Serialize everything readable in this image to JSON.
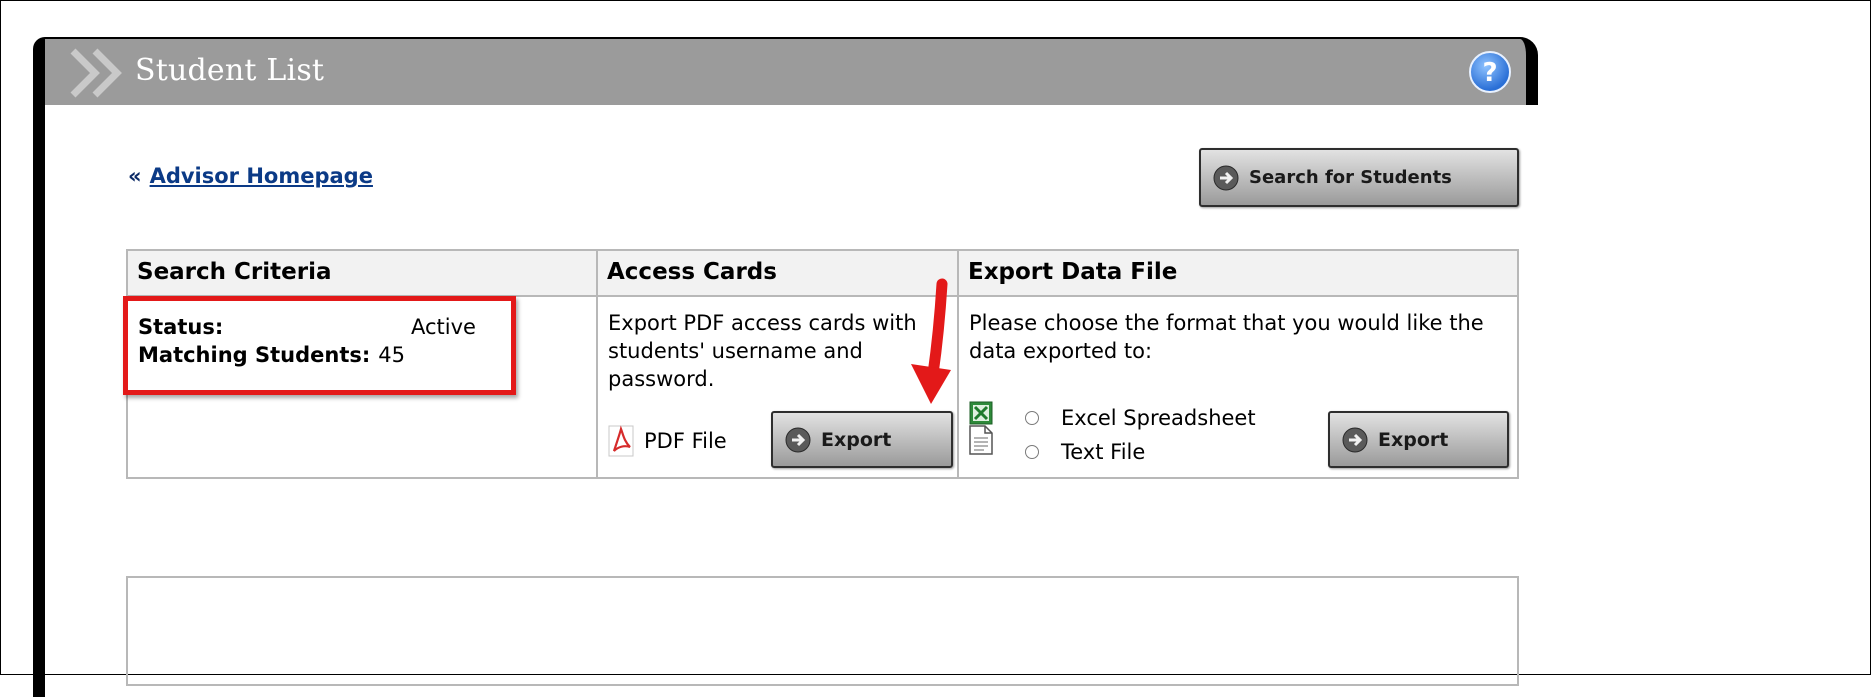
{
  "panel": {
    "title": "Student List"
  },
  "nav": {
    "back_prefix": "«",
    "back_link": "Advisor Homepage"
  },
  "buttons": {
    "search": "Search for Students",
    "export_pdf": "Export",
    "export_data": "Export"
  },
  "table": {
    "headers": [
      "Search Criteria",
      "Access Cards",
      "Export Data File"
    ],
    "criteria": {
      "status_label": "Status:",
      "status_value": "Active",
      "matching_label": "Matching Students:",
      "matching_value": "45"
    },
    "access_cards": {
      "description": "Export PDF access cards with students' username and password.",
      "pdf_label": "PDF File"
    },
    "export_data": {
      "description": "Please choose the format that you would like the data exported to:",
      "options": [
        "Excel Spreadsheet",
        "Text File"
      ]
    }
  },
  "colors": {
    "header_bg": "#9b9b9b",
    "highlight": "#e31919",
    "link": "#0b3a86",
    "arrow": "#e31919"
  },
  "icons": [
    "chevron-double-icon",
    "help-icon",
    "go-arrow-icon",
    "pdf-icon",
    "excel-icon",
    "text-file-icon",
    "red-arrow-annotation"
  ]
}
